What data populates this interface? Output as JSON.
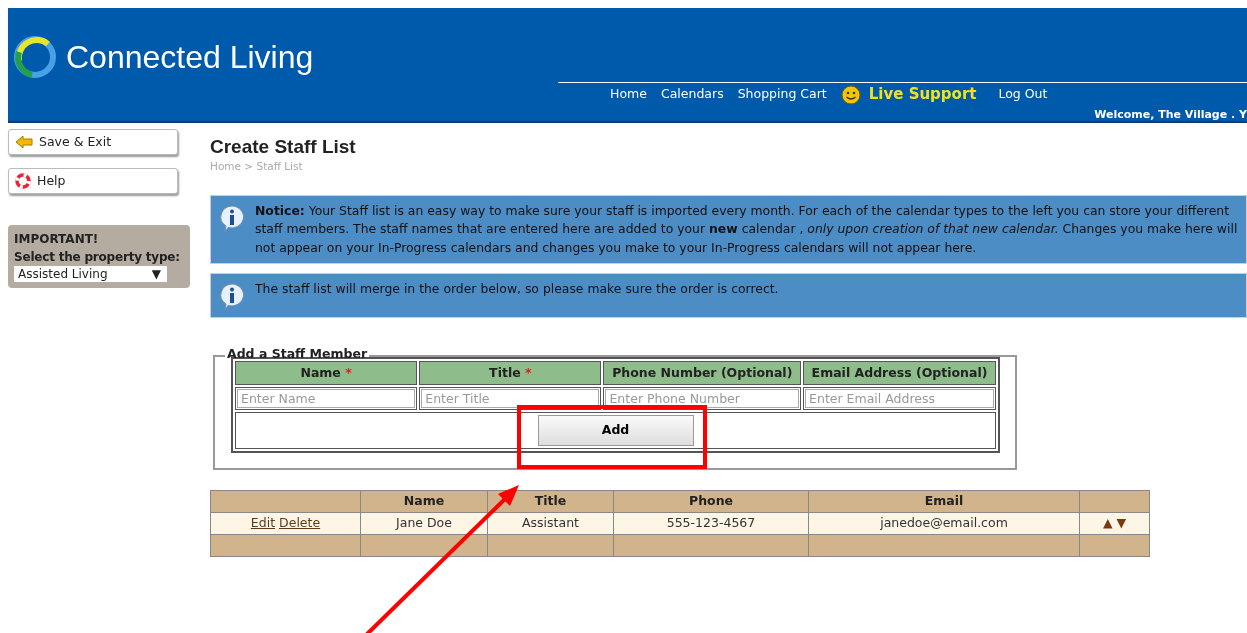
{
  "header": {
    "logo": {
      "light": "Connected",
      "bold": "Living"
    },
    "nav": [
      {
        "label": "Home",
        "kind": "link"
      },
      {
        "label": "Calendars",
        "kind": "link"
      },
      {
        "label": "Shopping Cart",
        "kind": "link"
      },
      {
        "label": "Live Support",
        "kind": "support"
      },
      {
        "label": "Log Out",
        "kind": "link"
      }
    ],
    "welcome": "Welcome, The Village . Y"
  },
  "sidebar": {
    "buttons": [
      {
        "label": "Save & Exit"
      },
      {
        "label": "Help"
      }
    ],
    "property": {
      "title": "IMPORTANT!",
      "label": "Select the property type:",
      "value": "Assisted Living",
      "arrow": "▼"
    }
  },
  "page": {
    "title": "Create Staff List",
    "breadcrumb": "Home > Staff List"
  },
  "notices": [
    "**Notice:** Your Staff list is an easy way to make sure your staff is imported every month. For each of the calendar types to the left you can store your different staff members. The staff names that are entered here are added to your **new** calendar , *only upon creation of that new calendar.* Changes you make here will not appear on your In-Progress calendars and changes you make to your In-Progress calendars will not appear here.",
    "The staff list will merge in the order below, so please make sure the order is correct."
  ],
  "form": {
    "legend": "Add a Staff Member",
    "fields": [
      {
        "label": "Name",
        "mark": "*",
        "placeholder": "Enter Name"
      },
      {
        "label": "Title",
        "mark": "*",
        "placeholder": "Enter Title"
      },
      {
        "label": "Phone Number (Optional)",
        "placeholder": "Enter Phone Number"
      },
      {
        "label": "Email Address (Optional)",
        "placeholder": "Enter Email Address"
      }
    ],
    "button": "Add"
  },
  "staff_table": {
    "columns": [
      "Name",
      "Title",
      "Phone",
      "Email"
    ],
    "rows": [
      {
        "actions": [
          "Edit",
          "Delete"
        ],
        "cells": [
          "Jane Doe",
          "Assistant",
          "555-123-4567",
          "janedoe@email.com"
        ],
        "move": [
          "▲",
          "▼"
        ]
      }
    ]
  },
  "annotations": [
    {
      "kind": "box"
    },
    {
      "kind": "arrow"
    }
  ]
}
